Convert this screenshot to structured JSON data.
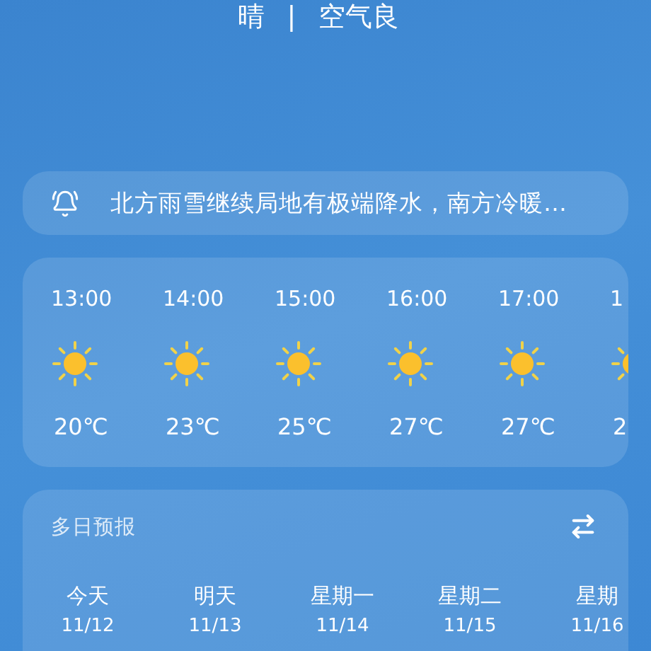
{
  "current": {
    "condition": "晴",
    "separator": "|",
    "air_quality": "空气良"
  },
  "notice": {
    "text": "北方雨雪继续局地有极端降水，南方冷暖…"
  },
  "hourly": [
    {
      "time": "13:00",
      "kind": "sunny",
      "temp": "20℃"
    },
    {
      "time": "14:00",
      "kind": "sunny",
      "temp": "23℃"
    },
    {
      "time": "15:00",
      "kind": "sunny",
      "temp": "25℃"
    },
    {
      "time": "16:00",
      "kind": "sunny",
      "temp": "27℃"
    },
    {
      "time": "17:00",
      "kind": "sunny",
      "temp": "27℃"
    },
    {
      "time": "1",
      "kind": "sunny",
      "temp": "2"
    }
  ],
  "daily": {
    "title": "多日预报",
    "days": [
      {
        "day": "今天",
        "date": "11/12"
      },
      {
        "day": "明天",
        "date": "11/13"
      },
      {
        "day": "星期一",
        "date": "11/14"
      },
      {
        "day": "星期二",
        "date": "11/15"
      },
      {
        "day": "星期",
        "date": "11/16"
      }
    ]
  }
}
